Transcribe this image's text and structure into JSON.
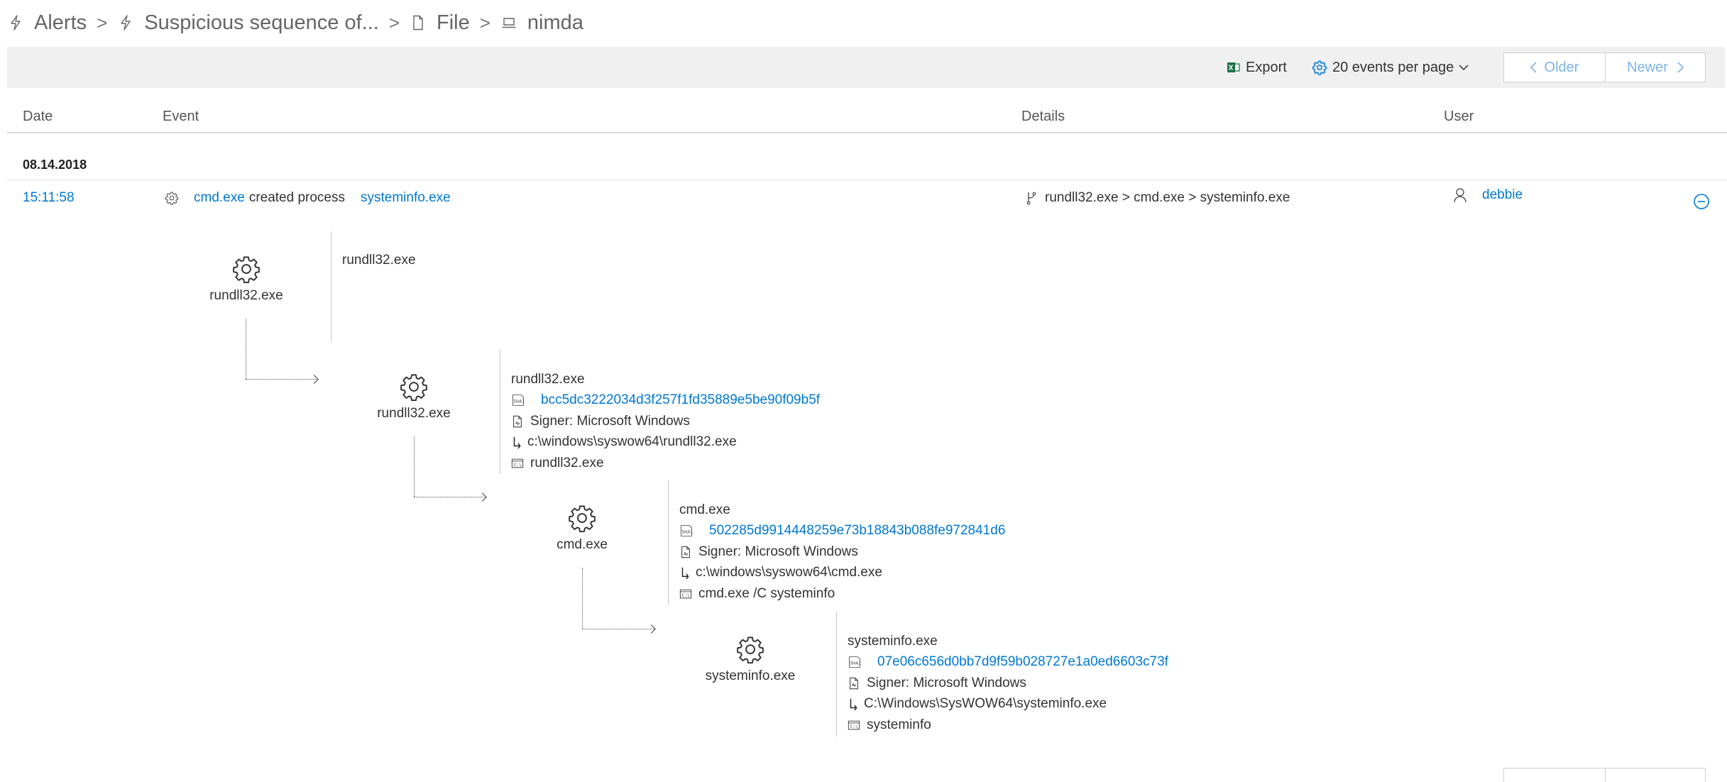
{
  "breadcrumb": [
    {
      "label": "Alerts",
      "icon": "bolt-icon"
    },
    {
      "label": "Suspicious sequence of...",
      "icon": "bolt-icon"
    },
    {
      "label": "File",
      "icon": "file-icon"
    },
    {
      "label": "nimda",
      "icon": "laptop-icon"
    }
  ],
  "breadcrumb_separator": ">",
  "toolbar": {
    "export_label": "Export",
    "export_icon": "excel-icon",
    "page_size_label": "20 events per page",
    "page_size_icon": "gear-icon",
    "older_label": "Older",
    "newer_label": "Newer"
  },
  "table": {
    "columns": [
      "Date",
      "Event",
      "Details",
      "User"
    ],
    "date_group": "08.14.2018",
    "row": {
      "time": "15:11:58",
      "event_source": "cmd.exe",
      "event_action": "created process",
      "event_target": "systeminfo.exe",
      "details": "rundll32.exe > cmd.exe > systeminfo.exe",
      "user": "debbie"
    }
  },
  "tree": {
    "root": {
      "name": "rundll32.exe",
      "label": "rundll32.exe"
    },
    "nodes": [
      {
        "name": "rundll32.exe",
        "title": "rundll32.exe",
        "sha1": "bcc5dc3222034d3f257f1fd35889e5be90f09b5f",
        "signer": "Signer: Microsoft Windows",
        "path": "c:\\windows\\syswow64\\rundll32.exe",
        "command": "rundll32.exe"
      },
      {
        "name": "cmd.exe",
        "title": "cmd.exe",
        "sha1": "502285d9914448259e73b18843b088fe972841d6",
        "signer": "Signer: Microsoft Windows",
        "path": "c:\\windows\\syswow64\\cmd.exe",
        "command": "cmd.exe /C systeminfo"
      },
      {
        "name": "systeminfo.exe",
        "title": "systeminfo.exe",
        "sha1": "07e06c656d0bb7d9f59b028727e1a0ed6603c73f",
        "signer": "Signer: Microsoft Windows",
        "path": "C:\\Windows\\SysWOW64\\systeminfo.exe",
        "command": "systeminfo"
      }
    ],
    "icons": {
      "sha": "SHA1",
      "signer": "signer-icon",
      "path": "folder-path-icon",
      "command": "command-line-icon"
    }
  },
  "colors": {
    "link": "#0078d4",
    "toolbar_bg": "#f0f0f0",
    "disabled_nav": "#7db3e6"
  }
}
